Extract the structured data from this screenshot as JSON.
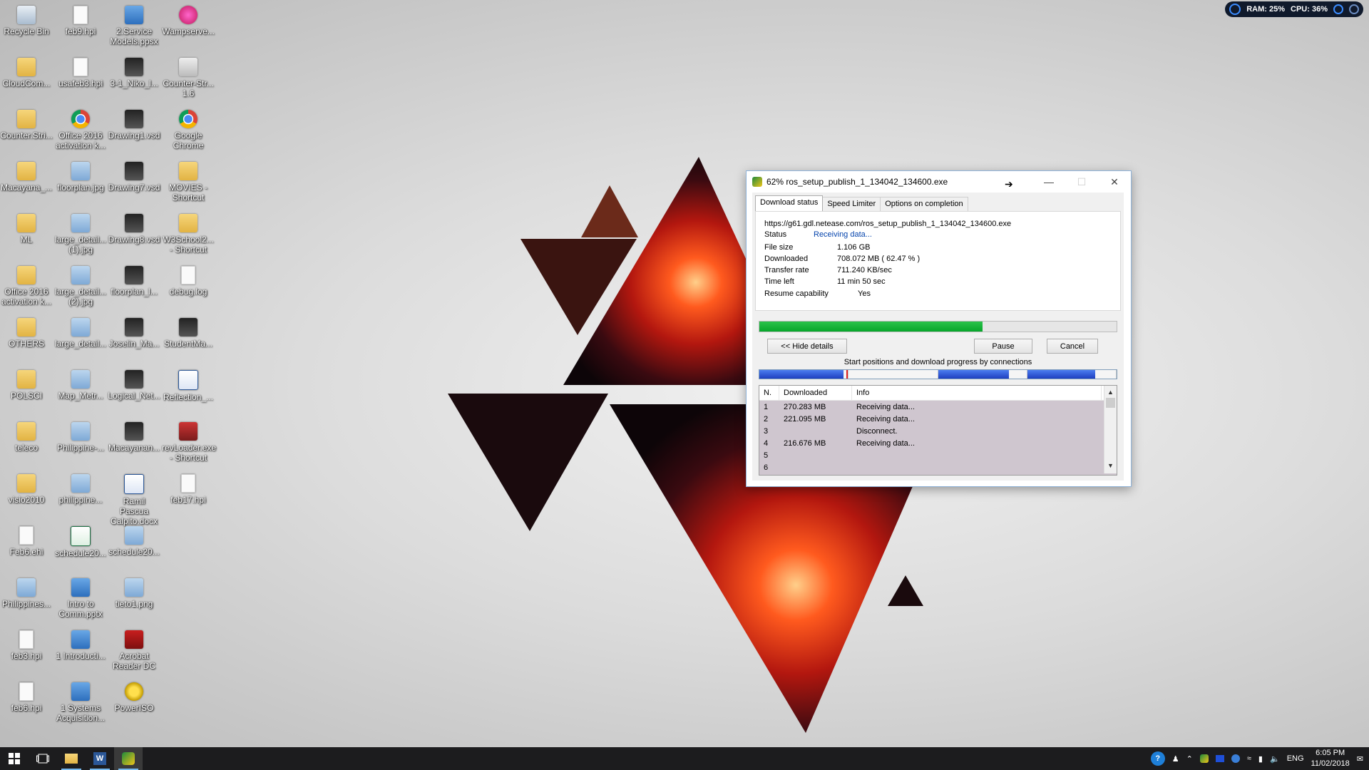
{
  "desktop": {
    "icons": [
      {
        "label": "Recycle Bin",
        "icon": "recycle-bin-icon"
      },
      {
        "label": "CloudCom...",
        "icon": "folder-icon"
      },
      {
        "label": "Counter.Stri...",
        "icon": "folder-icon"
      },
      {
        "label": "Macayana_...",
        "icon": "folder-icon"
      },
      {
        "label": "ML",
        "icon": "folder-icon"
      },
      {
        "label": "Office 2016 activation k...",
        "icon": "folder-icon"
      },
      {
        "label": "OTHERS",
        "icon": "folder-icon"
      },
      {
        "label": "POLSCI",
        "icon": "folder-icon"
      },
      {
        "label": "teleco",
        "icon": "folder-icon"
      },
      {
        "label": "visio2010",
        "icon": "folder-icon"
      },
      {
        "label": "Feb6.ehi",
        "icon": "file-icon"
      },
      {
        "label": "Philippines...",
        "icon": "image-file-icon"
      },
      {
        "label": "feb3.hpi",
        "icon": "file-icon"
      },
      {
        "label": "feb6.hpi",
        "icon": "file-icon"
      },
      {
        "label": "feb9.hpi",
        "icon": "file-icon"
      },
      {
        "label": "usafeb3.hpi",
        "icon": "file-icon"
      },
      {
        "label": "Office 2016 activation k...",
        "icon": "chrome-icon"
      },
      {
        "label": "floorplan.jpg",
        "icon": "image-file-icon"
      },
      {
        "label": "large_detail... (1).jpg",
        "icon": "image-file-icon"
      },
      {
        "label": "large_detail... (2).jpg",
        "icon": "image-file-icon"
      },
      {
        "label": "large_detail...",
        "icon": "image-file-icon"
      },
      {
        "label": "Map_Metr...",
        "icon": "image-file-icon"
      },
      {
        "label": "Philippine-...",
        "icon": "image-file-icon"
      },
      {
        "label": "philippine...",
        "icon": "image-file-icon"
      },
      {
        "label": "schedule20...",
        "icon": "excel-icon"
      },
      {
        "label": "Intro to Comm.pptx",
        "icon": "powerpoint-icon"
      },
      {
        "label": "1 Introducti...",
        "icon": "powerpoint-icon"
      },
      {
        "label": "1 Systems Acquisition...",
        "icon": "powerpoint-icon"
      },
      {
        "label": "2.Service Models.ppsx",
        "icon": "powerpoint-icon"
      },
      {
        "label": "3-1_Niko_l...",
        "icon": "visio-icon"
      },
      {
        "label": "Drawing1.vsd",
        "icon": "visio-icon"
      },
      {
        "label": "Drawing7.vsd",
        "icon": "visio-icon"
      },
      {
        "label": "Drawing8.vsd",
        "icon": "visio-icon"
      },
      {
        "label": "floorplan_l...",
        "icon": "visio-icon"
      },
      {
        "label": "Joselin_Ma...",
        "icon": "visio-icon"
      },
      {
        "label": "Logical_Net...",
        "icon": "visio-icon"
      },
      {
        "label": "Macayanan...",
        "icon": "visio-icon"
      },
      {
        "label": "Ramil Pascua Calpito.docx",
        "icon": "word-icon"
      },
      {
        "label": "schedule20...",
        "icon": "image-file-icon"
      },
      {
        "label": "tieto1.png",
        "icon": "image-file-icon"
      },
      {
        "label": "Acrobat Reader DC",
        "icon": "acrobat-icon"
      },
      {
        "label": "PowerISO",
        "icon": "poweriso-icon"
      },
      {
        "label": "Wampserve...",
        "icon": "wampserver-icon"
      },
      {
        "label": "Counter-Str... 1.6",
        "icon": "counter-strike-icon"
      },
      {
        "label": "Google Chrome",
        "icon": "chrome-icon"
      },
      {
        "label": "MOVIES - Shortcut",
        "icon": "shortcut-icon"
      },
      {
        "label": "W3School2... - Shortcut",
        "icon": "shortcut-icon"
      },
      {
        "label": "debug.log",
        "icon": "file-icon"
      },
      {
        "label": "StudentMa...",
        "icon": "archive-icon"
      },
      {
        "label": "Reflection_...",
        "icon": "word-icon"
      },
      {
        "label": "revLoader.exe - Shortcut",
        "icon": "exe-icon"
      },
      {
        "label": "feb17.hpi",
        "icon": "file-icon"
      }
    ]
  },
  "sysmon": {
    "ram_label": "RAM:",
    "ram_value": "25%",
    "cpu_label": "CPU:",
    "cpu_value": "36%"
  },
  "idm": {
    "title": "62% ros_setup_publish_1_134042_134600.exe",
    "tabs": [
      "Download status",
      "Speed Limiter",
      "Options on completion"
    ],
    "url": "https://g61.gdl.netease.com/ros_setup_publish_1_134042_134600.exe",
    "status_label": "Status",
    "status_value": "Receiving data...",
    "fields": [
      {
        "label": "File size",
        "value": "1.106  GB"
      },
      {
        "label": "Downloaded",
        "value": "708.072  MB  ( 62.47 % )"
      },
      {
        "label": "Transfer rate",
        "value": "711.240  KB/sec"
      },
      {
        "label": "Time left",
        "value": "11 min 50 sec"
      },
      {
        "label": "Resume capability",
        "value": "Yes"
      }
    ],
    "progress_fraction": 0.6247,
    "hide_details_label": "<< Hide details",
    "pause_label": "Pause",
    "cancel_label": "Cancel",
    "connections_label": "Start positions and download progress by connections",
    "connection_segments": [
      {
        "fraction": 0.25,
        "filled": 0.95
      },
      {
        "fraction": 0.25,
        "filled": 0.0
      },
      {
        "fraction": 0.25,
        "filled": 0.8
      },
      {
        "fraction": 0.25,
        "filled": 0.77
      }
    ],
    "table_headers": [
      "N.",
      "Downloaded",
      "Info"
    ],
    "rows": [
      {
        "n": "1",
        "downloaded": "270.283  MB",
        "info": "Receiving data..."
      },
      {
        "n": "2",
        "downloaded": "221.095  MB",
        "info": "Receiving data..."
      },
      {
        "n": "3",
        "downloaded": "",
        "info": "Disconnect."
      },
      {
        "n": "4",
        "downloaded": "216.676  MB",
        "info": "Receiving data..."
      },
      {
        "n": "5",
        "downloaded": "",
        "info": ""
      },
      {
        "n": "6",
        "downloaded": "",
        "info": ""
      }
    ]
  },
  "taskbar": {
    "apps": [
      {
        "name": "file-explorer",
        "open": true
      },
      {
        "name": "word",
        "open": true
      },
      {
        "name": "internet-download-manager",
        "open": true
      }
    ],
    "language": "ENG",
    "time": "6:05 PM",
    "date": "11/02/2018"
  }
}
